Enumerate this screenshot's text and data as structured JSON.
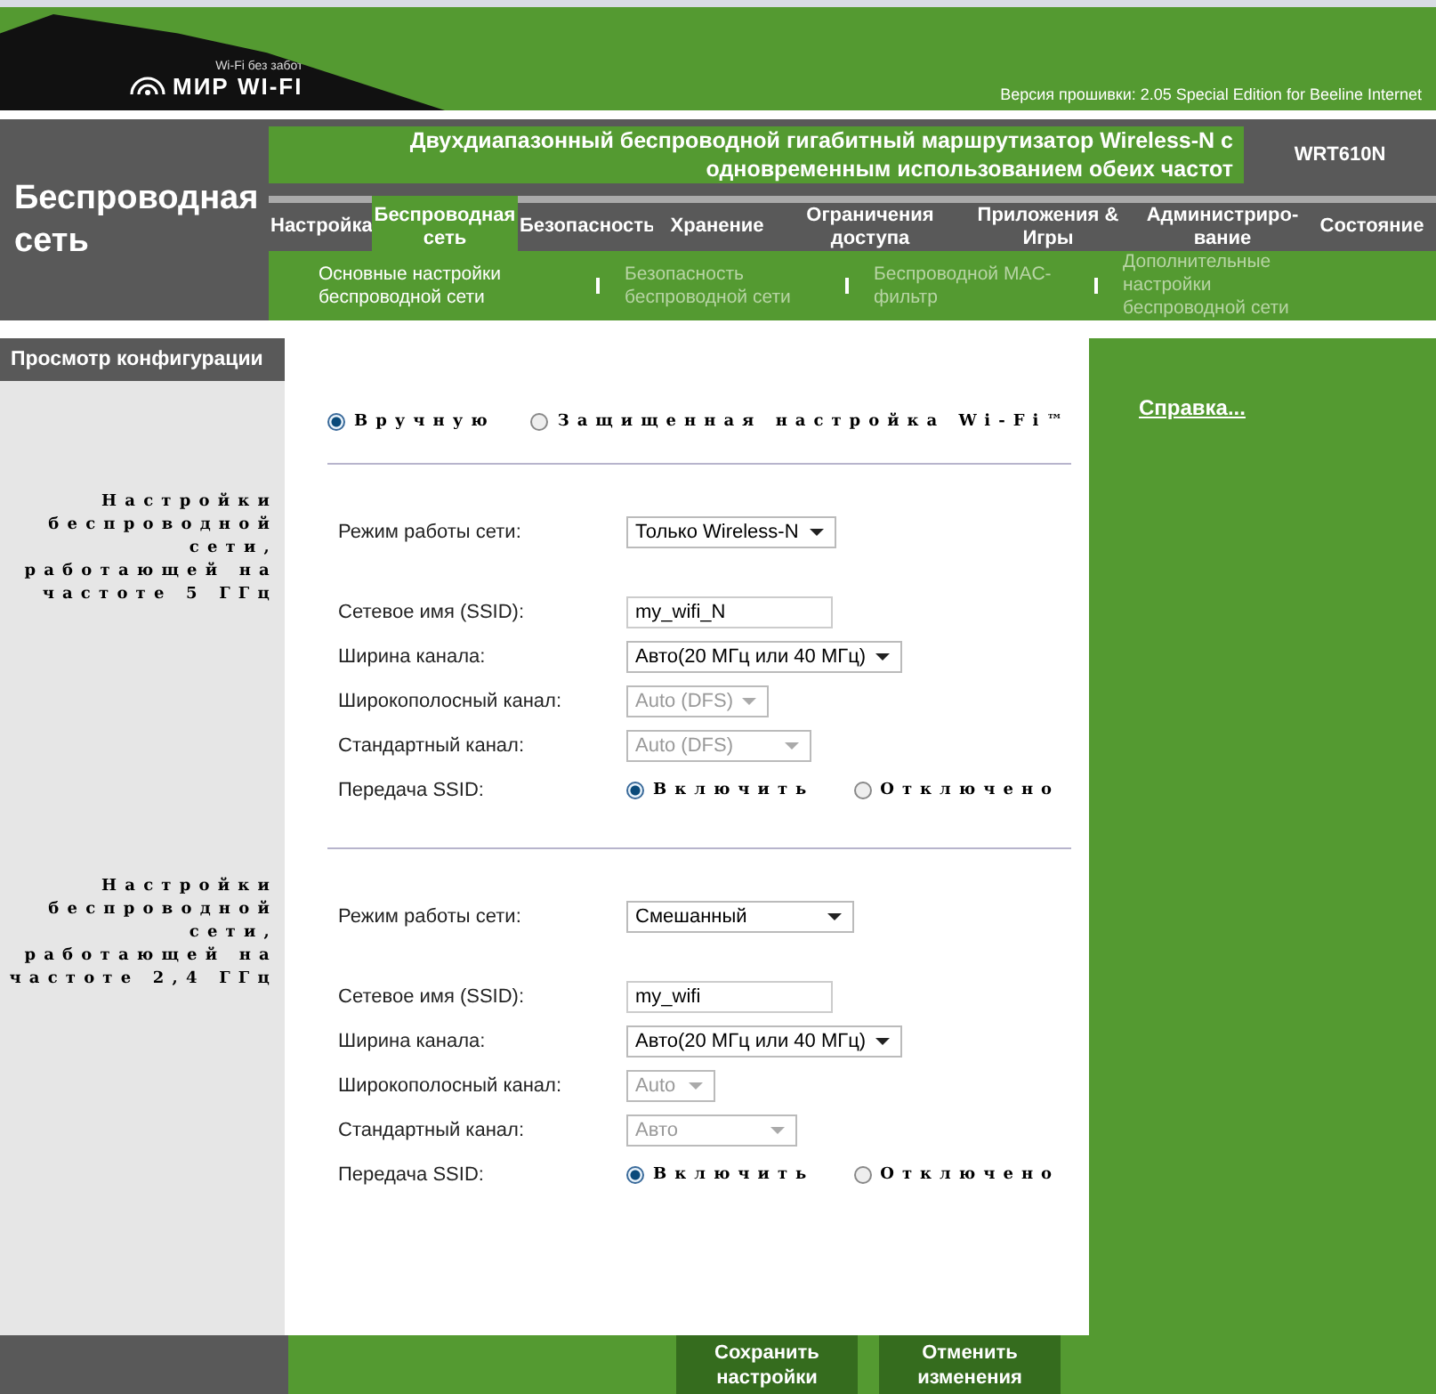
{
  "header": {
    "logo_tagline": "Wi-Fi без забот",
    "logo_text": "МИР WI-FI",
    "firmware": "Версия прошивки: 2.05 Special Edition for Beeline Internet"
  },
  "section_title": "Беспроводная сеть",
  "product_title": "Двухдиапазонный беспроводной гигабитный маршрутизатор Wireless-N с одновременным использованием обеих частот",
  "model": "WRT610N",
  "tabs": [
    {
      "label": "Настройка",
      "selected": false
    },
    {
      "label": "Беспроводная сеть",
      "selected": true
    },
    {
      "label": "Безопасность",
      "selected": false
    },
    {
      "label": "Хранение",
      "selected": false
    },
    {
      "label": "Ограничения доступа",
      "selected": false
    },
    {
      "label": "Приложения & Игры",
      "selected": false
    },
    {
      "label": "Администриро-вание",
      "selected": false
    },
    {
      "label": "Состояние",
      "selected": false
    }
  ],
  "subtabs": [
    {
      "label": "Основные настройки беспроводной сети",
      "selected": true
    },
    {
      "label": "Безопасность беспроводной сети",
      "selected": false
    },
    {
      "label": "Беспроводной MAC-фильтр",
      "selected": false
    },
    {
      "label": "Дополнительные настройки беспроводной сети",
      "selected": false
    }
  ],
  "sidebar_header": "Просмотр конфигурации",
  "help_link": "Справка...",
  "mode_options": [
    {
      "label": "Вручную",
      "selected": true
    },
    {
      "label": "Защищенная настройка Wi-Fi™",
      "selected": false
    }
  ],
  "sections": [
    {
      "heading": "Настройки беспроводной сети, работающей на частоте 5 ГГц",
      "fields": [
        {
          "kind": "select",
          "label": "Режим работы сети:",
          "value": "Только Wireless-N",
          "disabled": false
        },
        {
          "kind": "text",
          "label": "Сетевое имя (SSID):",
          "value": "my_wifi_N"
        },
        {
          "kind": "select",
          "label": "Ширина канала:",
          "value": "Авто(20 МГц или 40 МГц)",
          "disabled": false
        },
        {
          "kind": "select",
          "label": "Широкополосный канал:",
          "value": "Auto (DFS)",
          "disabled": true
        },
        {
          "kind": "select",
          "label": "Стандартный канал:",
          "value": "Auto (DFS)",
          "disabled": true
        },
        {
          "kind": "radio",
          "label": "Передача SSID:",
          "options": [
            {
              "label": "Включить",
              "selected": true
            },
            {
              "label": "Отключено",
              "selected": false
            }
          ]
        }
      ]
    },
    {
      "heading": "Настройки беспроводной сети, работающей на частоте 2,4 ГГц",
      "fields": [
        {
          "kind": "select",
          "label": "Режим работы сети:",
          "value": "Смешанный",
          "disabled": false
        },
        {
          "kind": "text",
          "label": "Сетевое имя (SSID):",
          "value": "my_wifi"
        },
        {
          "kind": "select",
          "label": "Ширина канала:",
          "value": "Авто(20 МГц или 40 МГц)",
          "disabled": false
        },
        {
          "kind": "select",
          "label": "Широкополосный канал:",
          "value": "Auto",
          "disabled": true
        },
        {
          "kind": "select",
          "label": "Стандартный канал:",
          "value": "Авто",
          "disabled": true
        },
        {
          "kind": "radio",
          "label": "Передача SSID:",
          "options": [
            {
              "label": "Включить",
              "selected": true
            },
            {
              "label": "Отключено",
              "selected": false
            }
          ]
        }
      ]
    }
  ],
  "buttons": [
    "Сохранить настройки",
    "Отменить изменения"
  ]
}
